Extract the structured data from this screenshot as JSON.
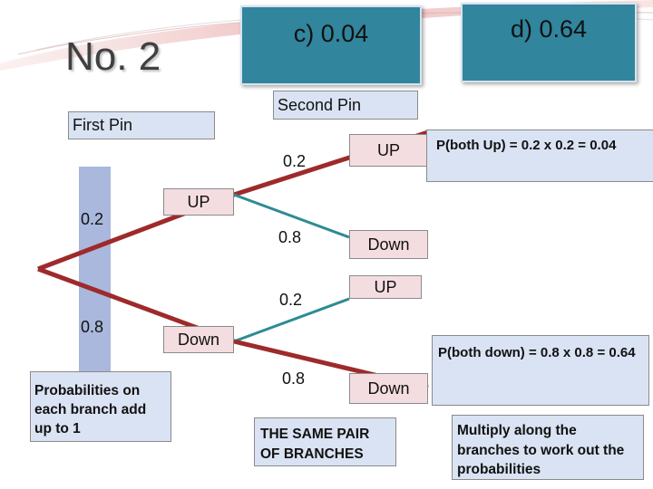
{
  "slide": {
    "title": "No. 2",
    "answer_options": [
      {
        "id": "c",
        "label": "c)  0.04"
      },
      {
        "id": "d",
        "label": "d)  0.64"
      }
    ],
    "headers": {
      "first_pin": "First Pin",
      "second_pin": "Second Pin"
    },
    "first_pin": {
      "probabilities": [
        "0.2",
        "0.8"
      ],
      "outcomes": [
        "UP",
        "Down"
      ]
    },
    "second_pin": {
      "branches": [
        {
          "from": "UP",
          "prob": "0.2",
          "outcome": "UP"
        },
        {
          "from": "UP",
          "prob": "0.8",
          "outcome": "Down"
        },
        {
          "from": "Down",
          "prob": "0.2",
          "outcome": "UP"
        },
        {
          "from": "Down",
          "prob": "0.8",
          "outcome": "Down"
        }
      ]
    },
    "notes": {
      "both_up": "P(both Up) = 0.2 x 0.2 =  0.04",
      "both_down": "P(both down) = 0.8 x 0.8 = 0.64",
      "branches_add": "Probabilities on each branch add up to 1",
      "same_pair": "THE SAME PAIR OF BRANCHES",
      "multiply": "Multiply along the branches to work out the probabilities"
    },
    "colors": {
      "branch_red": "#9e2a2b",
      "branch_teal": "#2e8b94",
      "teal_box": "#31859c",
      "lavender_box": "#dae3f3",
      "pink_box": "#f4dde0",
      "prob_bar": "#a9b8dc"
    }
  }
}
